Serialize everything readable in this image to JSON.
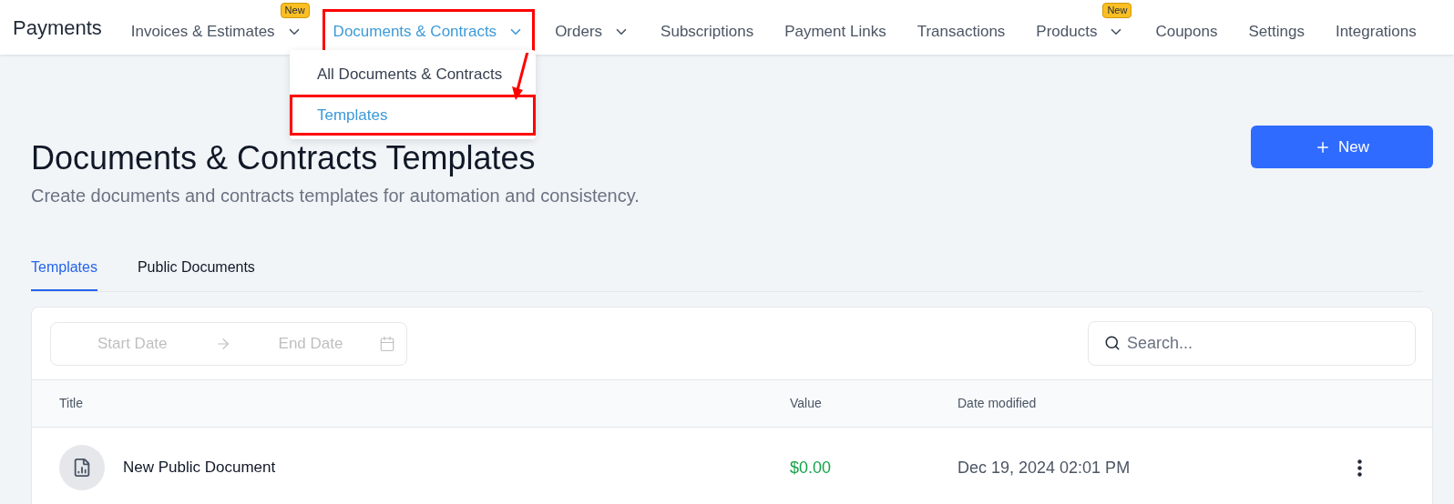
{
  "app": {
    "title": "Payments"
  },
  "nav": [
    {
      "label": "Invoices & Estimates",
      "selected": false,
      "has_dropdown": true,
      "badge": "New"
    },
    {
      "label": "Documents & Contracts",
      "selected": true,
      "has_dropdown": true
    },
    {
      "label": "Orders",
      "selected": false,
      "has_dropdown": true
    },
    {
      "label": "Subscriptions",
      "selected": false,
      "has_dropdown": false
    },
    {
      "label": "Payment Links",
      "selected": false,
      "has_dropdown": false
    },
    {
      "label": "Transactions",
      "selected": false,
      "has_dropdown": false
    },
    {
      "label": "Products",
      "selected": false,
      "has_dropdown": true,
      "badge": "New"
    },
    {
      "label": "Coupons",
      "selected": false,
      "has_dropdown": false
    },
    {
      "label": "Settings",
      "selected": false,
      "has_dropdown": false
    },
    {
      "label": "Integrations",
      "selected": false,
      "has_dropdown": false
    }
  ],
  "dropdown": {
    "items": [
      {
        "label": "All Documents & Contracts",
        "selected": false
      },
      {
        "label": "Templates",
        "selected": true
      }
    ]
  },
  "page": {
    "title": "Documents & Contracts Templates",
    "subtitle": "Create documents and contracts templates for automation and consistency.",
    "new_button": "New"
  },
  "tabs": [
    {
      "label": "Templates",
      "selected": true
    },
    {
      "label": "Public Documents",
      "selected": false
    }
  ],
  "filters": {
    "start_placeholder": "Start Date",
    "end_placeholder": "End Date",
    "search_placeholder": "Search..."
  },
  "table": {
    "columns": [
      "Title",
      "Value",
      "Date modified"
    ],
    "rows": [
      {
        "title": "New Public Document",
        "value": "$0.00",
        "date_modified": "Dec 19, 2024 02:01 PM"
      }
    ]
  }
}
